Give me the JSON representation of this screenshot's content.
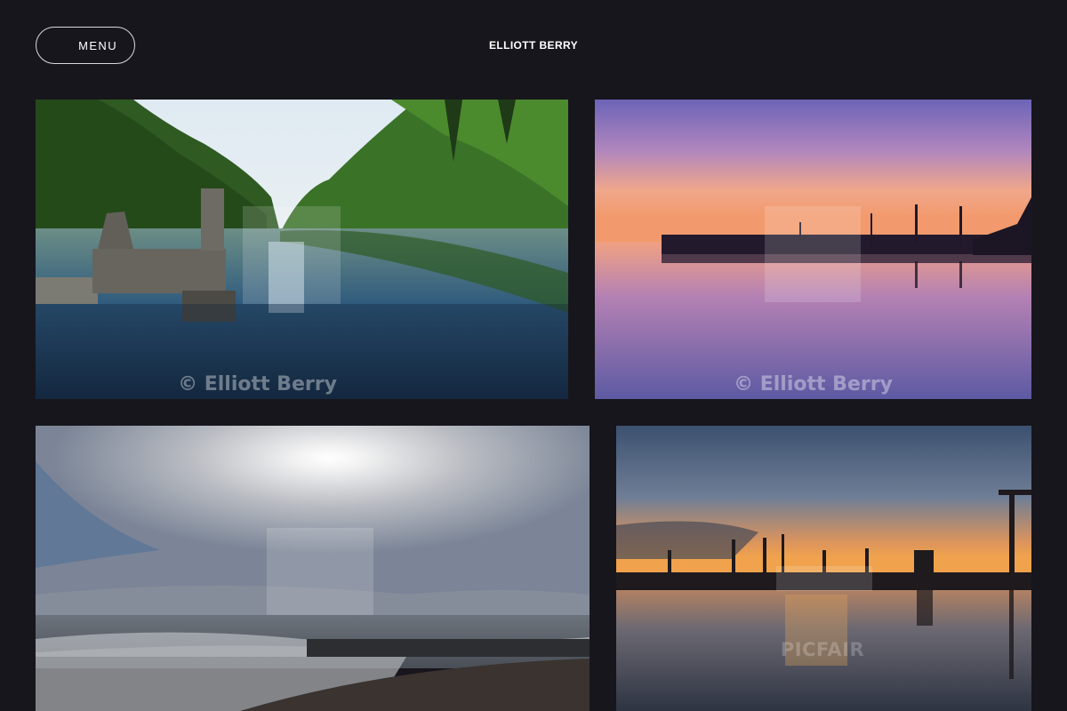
{
  "header": {
    "menu_label": "MENU",
    "site_title": "ELLIOTT BERRY"
  },
  "gallery": {
    "photos": [
      {
        "subject": "river with stone ruin and trees",
        "watermark": "© Elliott Berry"
      },
      {
        "subject": "harbour at sunset with boat masts",
        "watermark": "© Elliott Berry"
      },
      {
        "subject": "sea and beach under cloudy sky with sun",
        "watermark": ""
      },
      {
        "subject": "port cranes silhouetted at sunset",
        "watermark": "PICFAIR"
      }
    ]
  }
}
